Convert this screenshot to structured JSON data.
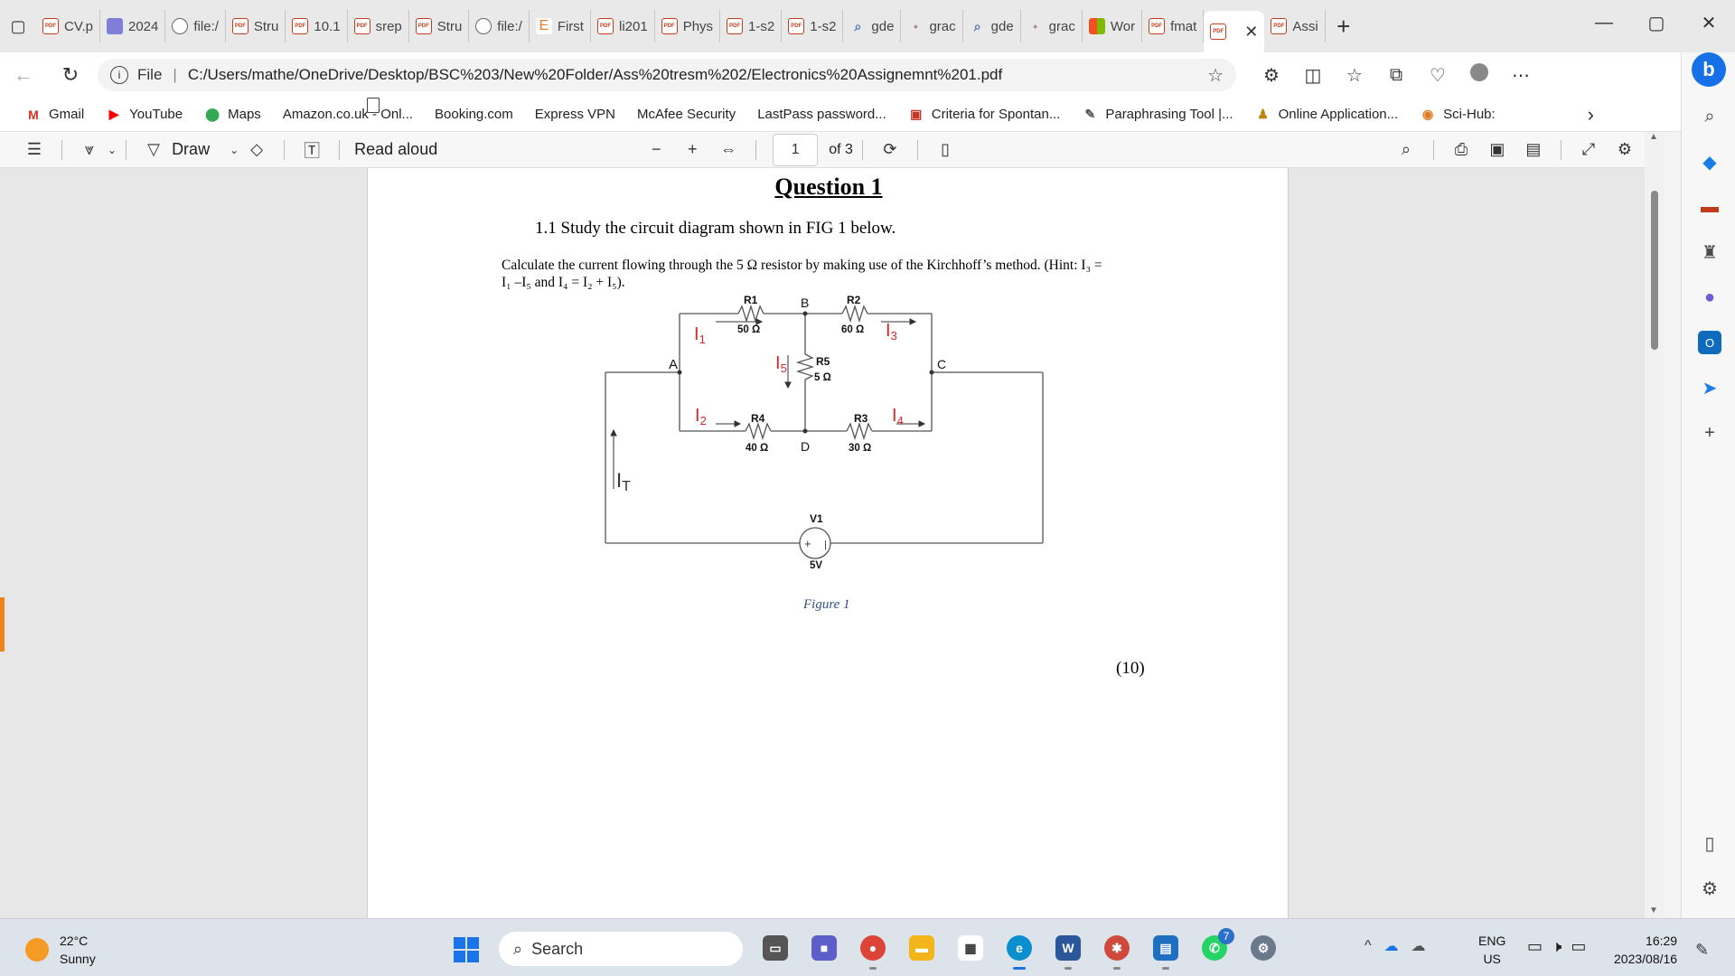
{
  "tabs": [
    {
      "label": "CV.p",
      "fav": "pdf"
    },
    {
      "label": "2024",
      "fav": "list"
    },
    {
      "label": "file:/",
      "fav": "file"
    },
    {
      "label": "Stru",
      "fav": "pdf"
    },
    {
      "label": "10.1",
      "fav": "pdf"
    },
    {
      "label": "srep",
      "fav": "pdf"
    },
    {
      "label": "Stru",
      "fav": "pdf"
    },
    {
      "label": "file:/",
      "fav": "file"
    },
    {
      "label": "First",
      "fav": "e"
    },
    {
      "label": "li201",
      "fav": "pdf"
    },
    {
      "label": "Phys",
      "fav": "pdf"
    },
    {
      "label": "1-s2",
      "fav": "pdf"
    },
    {
      "label": "1-s2",
      "fav": "pdf"
    },
    {
      "label": "gde",
      "fav": "search"
    },
    {
      "label": "grac",
      "fav": "grac"
    },
    {
      "label": "gde",
      "fav": "search"
    },
    {
      "label": "grac",
      "fav": "grac"
    },
    {
      "label": "Wor",
      "fav": "ms"
    },
    {
      "label": "fmat",
      "fav": "pdf"
    },
    {
      "label": "",
      "fav": "pdf",
      "active": true
    },
    {
      "label": "Assi",
      "fav": "pdf"
    }
  ],
  "address": {
    "scheme": "File",
    "url": "C:/Users/mathe/OneDrive/Desktop/BSC%203/New%20Folder/Ass%20tresm%202/Electronics%20Assignemnt%201.pdf"
  },
  "bookmarks": [
    {
      "label": "Gmail",
      "icon": "gmail-icon"
    },
    {
      "label": "YouTube",
      "icon": "youtube-icon"
    },
    {
      "label": "Maps",
      "icon": "maps-icon"
    },
    {
      "label": "Amazon.co.uk - Onl...",
      "icon": "page-icon"
    },
    {
      "label": "Booking.com",
      "icon": "page-icon"
    },
    {
      "label": "Express VPN",
      "icon": "page-icon"
    },
    {
      "label": "McAfee Security",
      "icon": "page-icon"
    },
    {
      "label": "LastPass password...",
      "icon": "page-icon"
    },
    {
      "label": "Criteria for Spontan...",
      "icon": "monitor-icon"
    },
    {
      "label": "Paraphrasing Tool |...",
      "icon": "quill-icon"
    },
    {
      "label": "Online Application...",
      "icon": "person-icon"
    },
    {
      "label": "Sci-Hub:",
      "icon": "scihub-icon"
    }
  ],
  "pdf_toolbar": {
    "draw": "Draw",
    "read_aloud": "Read aloud",
    "page": "1",
    "of_pages": "of 3"
  },
  "document": {
    "title": "Question 1",
    "line1": "1.1 Study the circuit diagram shown in FIG 1 below.",
    "line2a": "Calculate the current flowing through the 5 Ω resistor by making use of the Kirchhoff’s method. (Hint: I₃ =",
    "line2b": "I₁ –I₅ and I₄ = I₂ + I₅).",
    "figure_caption": "Figure 1",
    "marks": "(10)"
  },
  "circuit": {
    "nodes": {
      "a": "A",
      "b": "B",
      "c": "C",
      "d": "D"
    },
    "r1": {
      "name": "R1",
      "value": "50 Ω"
    },
    "r2": {
      "name": "R2",
      "value": "60 Ω"
    },
    "r3": {
      "name": "R3",
      "value": "30 Ω"
    },
    "r4": {
      "name": "R4",
      "value": "40 Ω"
    },
    "r5": {
      "name": "R5",
      "value": "5 Ω"
    },
    "source": {
      "name": "V1",
      "value": "5V"
    },
    "currents": {
      "i1": "I",
      "i1s": "1",
      "i2": "I",
      "i2s": "2",
      "i3": "I",
      "i3s": "3",
      "i4": "I",
      "i4s": "4",
      "i5": "I",
      "i5s": "5",
      "it": "I",
      "its": "T"
    },
    "colors": {
      "current_label": "#d9262c",
      "wire": "#555555"
    }
  },
  "taskbar": {
    "temp": "22°C",
    "condition": "Sunny",
    "search": "Search",
    "lang1": "ENG",
    "lang2": "US",
    "time": "16:29",
    "date": "2023/08/16",
    "whatsapp_badge": "7"
  }
}
